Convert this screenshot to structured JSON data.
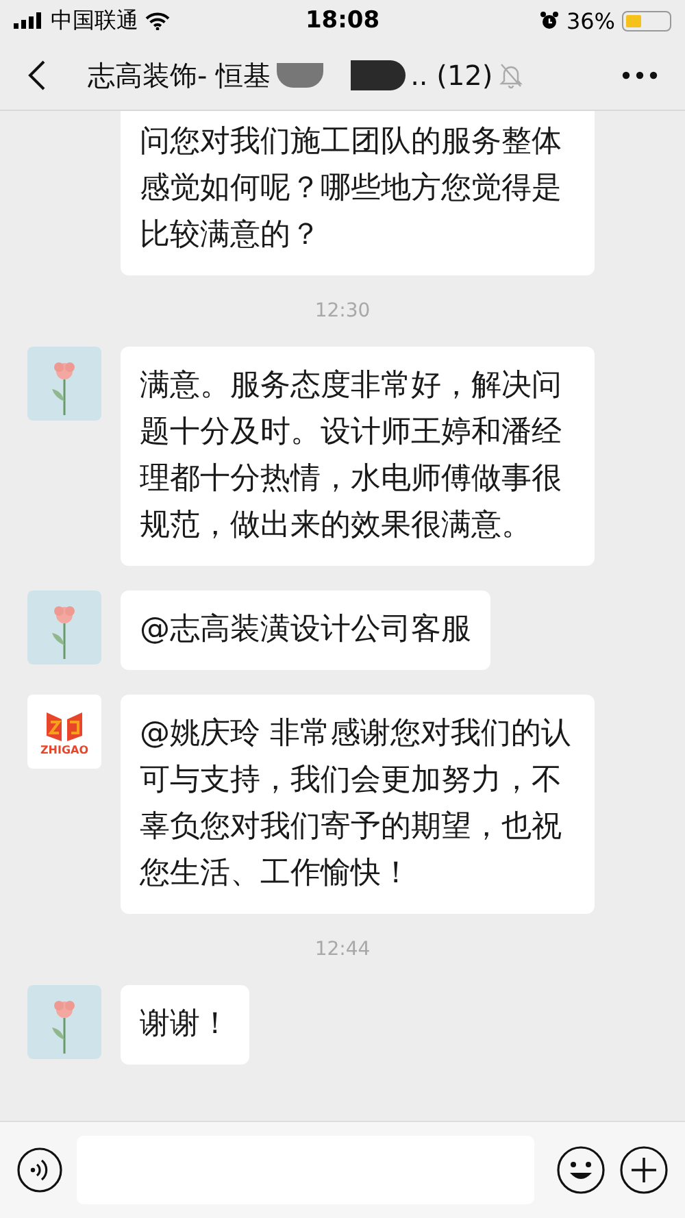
{
  "status_bar": {
    "carrier": "中国联通",
    "time": "18:08",
    "battery": "36%",
    "level": 0.36
  },
  "nav": {
    "title": "志高装饰- 恒基",
    "title_suffix": ".. (12)",
    "muted": true
  },
  "messages": [
    {
      "kind": "text",
      "text": "问您对我们施工团队的服务整体感觉如何呢？哪些地方您觉得是比较满意的？"
    },
    {
      "kind": "time",
      "text": "12:30"
    },
    {
      "kind": "text",
      "avatar": {
        "kind": "flower"
      },
      "text": "满意。服务态度非常好，解决问题十分及时。设计师王婷和潘经理都十分热情，水电师傅做事很规范，做出来的效果很满意。"
    },
    {
      "kind": "text",
      "avatar": {
        "kind": "flower"
      },
      "text": "@志高装潢设计公司客服"
    },
    {
      "kind": "text",
      "avatar": {
        "kind": "logo",
        "text": "ZHIGAO"
      },
      "text": "@姚庆玲  非常感谢您对我们的认可与支持，我们会更加努力，不辜负您对我们寄予的期望，也祝您生活、工作愉快！"
    },
    {
      "kind": "time",
      "text": "12:44"
    },
    {
      "kind": "text",
      "avatar": {
        "kind": "flower"
      },
      "text": "谢谢！"
    }
  ]
}
